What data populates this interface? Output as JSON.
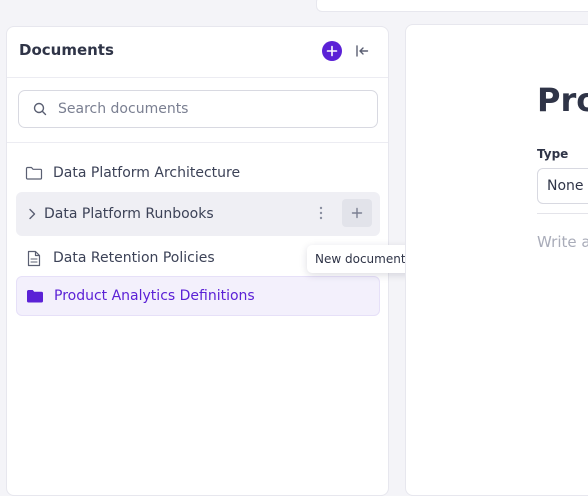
{
  "sidebar": {
    "title": "Documents",
    "search": {
      "placeholder": "Search documents",
      "value": ""
    },
    "items": [
      {
        "label": "Data Platform Architecture",
        "icon": "folder-icon",
        "state": "default"
      },
      {
        "label": "Data Platform Runbooks",
        "icon": "chevron-right-icon",
        "state": "hover"
      },
      {
        "label": "Data Retention Policies",
        "icon": "document-icon",
        "state": "default"
      },
      {
        "label": "Product Analytics Definitions",
        "icon": "folder-filled-icon",
        "state": "selected"
      }
    ]
  },
  "tooltip": {
    "text": "New document"
  },
  "main": {
    "title": "Pro",
    "type_label": "Type",
    "type_value": "None",
    "body_placeholder": "Write a"
  },
  "colors": {
    "accent": "#5b21d6",
    "text": "#3c4257",
    "muted": "#7a7f91",
    "background": "#f4f4f8"
  }
}
